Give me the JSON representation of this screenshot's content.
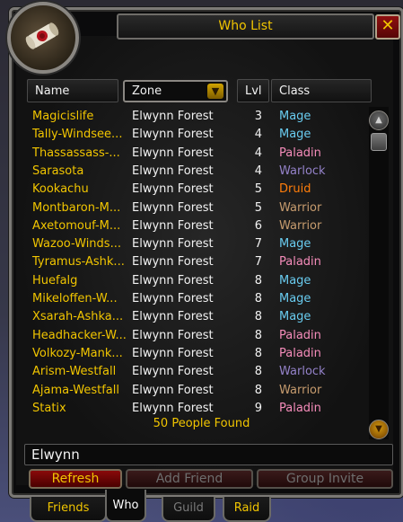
{
  "window": {
    "title": "Who List",
    "close_label": "✕"
  },
  "columns": {
    "name": "Name",
    "zone": "Zone",
    "level": "Lvl",
    "class": "Class"
  },
  "class_colors": {
    "Mage": "#69ccf0",
    "Paladin": "#f58cba",
    "Warlock": "#9482c9",
    "Druid": "#ff7d0a",
    "Warrior": "#c79c6e"
  },
  "rows": [
    {
      "name": "Magicislife",
      "zone": "Elwynn Forest",
      "level": "3",
      "class": "Mage"
    },
    {
      "name": "Tally-Windsee...",
      "zone": "Elwynn Forest",
      "level": "4",
      "class": "Mage"
    },
    {
      "name": "Thassassass-...",
      "zone": "Elwynn Forest",
      "level": "4",
      "class": "Paladin"
    },
    {
      "name": "Sarasota",
      "zone": "Elwynn Forest",
      "level": "4",
      "class": "Warlock"
    },
    {
      "name": "Kookachu",
      "zone": "Elwynn Forest",
      "level": "5",
      "class": "Druid"
    },
    {
      "name": "Montbaron-M...",
      "zone": "Elwynn Forest",
      "level": "5",
      "class": "Warrior"
    },
    {
      "name": "Axetomouf-M...",
      "zone": "Elwynn Forest",
      "level": "6",
      "class": "Warrior"
    },
    {
      "name": "Wazoo-Winds...",
      "zone": "Elwynn Forest",
      "level": "7",
      "class": "Mage"
    },
    {
      "name": "Tyramus-Ashk...",
      "zone": "Elwynn Forest",
      "level": "7",
      "class": "Paladin"
    },
    {
      "name": "Huefalg",
      "zone": "Elwynn Forest",
      "level": "8",
      "class": "Mage"
    },
    {
      "name": "Mikeloffen-W...",
      "zone": "Elwynn Forest",
      "level": "8",
      "class": "Mage"
    },
    {
      "name": "Xsarah-Ashka...",
      "zone": "Elwynn Forest",
      "level": "8",
      "class": "Mage"
    },
    {
      "name": "Headhacker-W...",
      "zone": "Elwynn Forest",
      "level": "8",
      "class": "Paladin"
    },
    {
      "name": "Volkozy-Mank...",
      "zone": "Elwynn Forest",
      "level": "8",
      "class": "Paladin"
    },
    {
      "name": "Arism-Westfall",
      "zone": "Elwynn Forest",
      "level": "8",
      "class": "Warlock"
    },
    {
      "name": "Ajama-Westfall",
      "zone": "Elwynn Forest",
      "level": "8",
      "class": "Warrior"
    },
    {
      "name": "Statix",
      "zone": "Elwynn Forest",
      "level": "9",
      "class": "Paladin"
    }
  ],
  "found_text": "50 People Found",
  "search": {
    "value": "Elwynn"
  },
  "buttons": {
    "refresh": "Refresh",
    "add_friend": "Add Friend",
    "group_invite": "Group Invite"
  },
  "tabs": {
    "friends": "Friends",
    "who": "Who",
    "guild": "Guild",
    "raid": "Raid"
  }
}
